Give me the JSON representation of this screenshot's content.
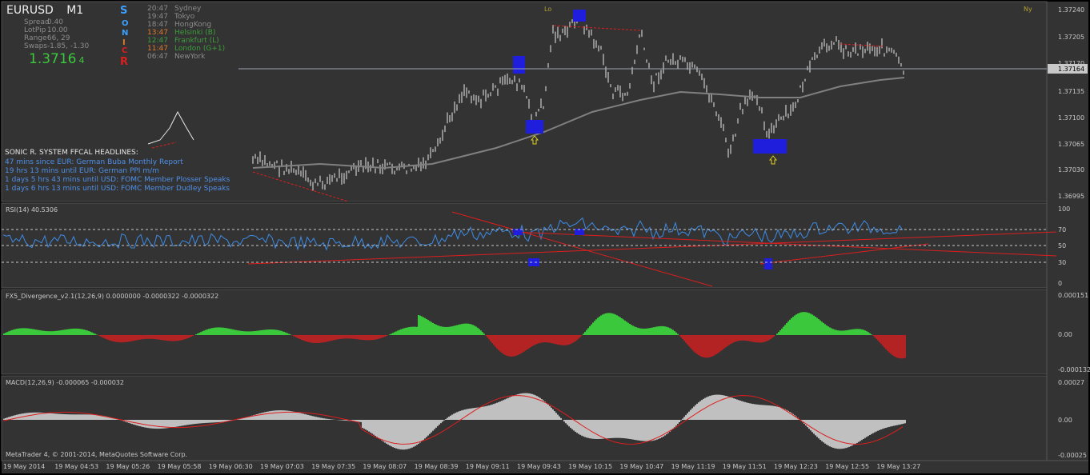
{
  "colors": {
    "background": "#000000",
    "panel": "#333333",
    "grid_border": "#555555",
    "text": "#c8c8c8",
    "bull_green": "#3cc83c",
    "bear_red": "#b42323",
    "macd_hist": "#c0c0c0",
    "rsi_line": "#3c8ce6",
    "signal_blue": "#1e1edc",
    "trend_red": "#dc1e1e",
    "ma_gray": "#808080",
    "sessions_up_orange": "#e07b28",
    "sessions_green": "#3c9f3c"
  },
  "header": {
    "symbol": "EURUSD",
    "timeframe": "M1",
    "stats": [
      {
        "label": "Spread",
        "value": "0.40"
      },
      {
        "label": "LotPip",
        "value": "10.00"
      },
      {
        "label": "Range",
        "value": "66, 29"
      },
      {
        "label": "Swaps",
        "value": "-1.85, -1.30"
      }
    ],
    "price_main": "1.3716",
    "price_sub": "4",
    "sonic_letters": [
      "S",
      "O",
      "N",
      "I",
      "C",
      "R"
    ]
  },
  "sessions": [
    {
      "time": "20:47",
      "city": "Sydney"
    },
    {
      "time": "19:47",
      "city": "Tokyo"
    },
    {
      "time": "18:47",
      "city": "HongKong"
    },
    {
      "time": "13:47",
      "city": "Helsinki  (B)"
    },
    {
      "time": "12:47",
      "city": "Frankfurt  (L)"
    },
    {
      "time": "11:47",
      "city": "London  (G+1)"
    },
    {
      "time": "06:47",
      "city": "NewYork"
    }
  ],
  "headlines": {
    "title": "SONIC R. SYSTEM  FFCAL HEADLINES:",
    "items": [
      "47 mins since EUR: German Buba Monthly Report",
      "19 hrs 13 mins until EUR: German PPI m/m",
      "1 days 5 hrs 43 mins until USD: FOMC Member Plosser Speaks",
      "1 days 6 hrs 13 mins until USD: FOMC Member Dudley Speaks"
    ]
  },
  "markers": {
    "lo": "Lo",
    "ny": "Ny"
  },
  "price_axis": {
    "ticks": [
      "1.37240",
      "1.37205",
      "1.37170",
      "1.37135",
      "1.37100",
      "1.37065",
      "1.37030",
      "1.36995"
    ],
    "current": "1.37164"
  },
  "panels": {
    "rsi": {
      "label": "RSI(14) 40.5306",
      "ticks": [
        "100",
        "70",
        "50",
        "30",
        "0"
      ]
    },
    "fx5": {
      "label": "FX5_Divergence_v2.1(12,26,9) 0.0000000 -0.0000322 -0.0000322",
      "ticks": [
        "0.000151",
        "0.00",
        "-0.000132"
      ]
    },
    "macd": {
      "label": "MACD(12,26,9) -0.000065 -0.000032",
      "ticks": [
        "0.00027",
        "0.00",
        "-0.00025"
      ]
    }
  },
  "copyright": "MetaTrader 4, © 2001-2014, MetaQuotes Software Corp.",
  "time_axis": [
    "19 May 2014",
    "19 May 04:53",
    "19 May 05:26",
    "19 May 05:58",
    "19 May 06:30",
    "19 May 07:03",
    "19 May 07:35",
    "19 May 08:07",
    "19 May 08:39",
    "19 May 09:11",
    "19 May 09:43",
    "19 May 10:15",
    "19 May 10:47",
    "19 May 11:19",
    "19 May 11:51",
    "19 May 12:23",
    "19 May 12:55",
    "19 May 13:27"
  ]
}
